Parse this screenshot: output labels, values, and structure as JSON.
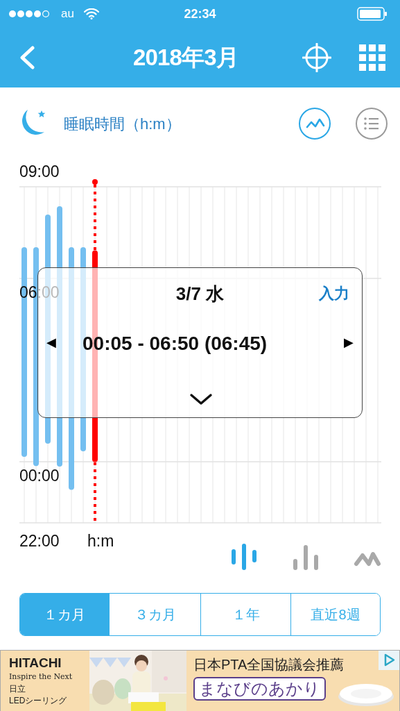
{
  "status_bar": {
    "carrier": "au",
    "time": "22:34"
  },
  "header": {
    "title": "2018年3月"
  },
  "section": {
    "title": "睡眠時間（h:m）",
    "view_toggles": [
      {
        "kind": "chart",
        "selected": true
      },
      {
        "kind": "list",
        "selected": false
      }
    ]
  },
  "chart": {
    "y_labels": [
      "09:00",
      "06:00",
      "00:00",
      "22:00"
    ],
    "unit": "h:m"
  },
  "chart_styles": [
    {
      "kind": "range",
      "selected": true
    },
    {
      "kind": "bar",
      "selected": false
    },
    {
      "kind": "line",
      "selected": false
    }
  ],
  "popup": {
    "date": "3/7 水",
    "action": "入力",
    "prev": "◀",
    "range": "00:05 - 06:50 (06:45)",
    "next": "▶"
  },
  "period_tabs": [
    {
      "label": "１カ月",
      "selected": true
    },
    {
      "label": "３カ月",
      "selected": false
    },
    {
      "label": "１年",
      "selected": false
    },
    {
      "label": "直近8週",
      "selected": false
    }
  ],
  "ad": {
    "brand": "HITACHI",
    "tagline": "Inspire the Next",
    "product_lines": [
      "日立",
      "LEDシーリング"
    ],
    "headline": "日本PTA全国協議会推薦",
    "title": "まなびのあかり"
  }
}
